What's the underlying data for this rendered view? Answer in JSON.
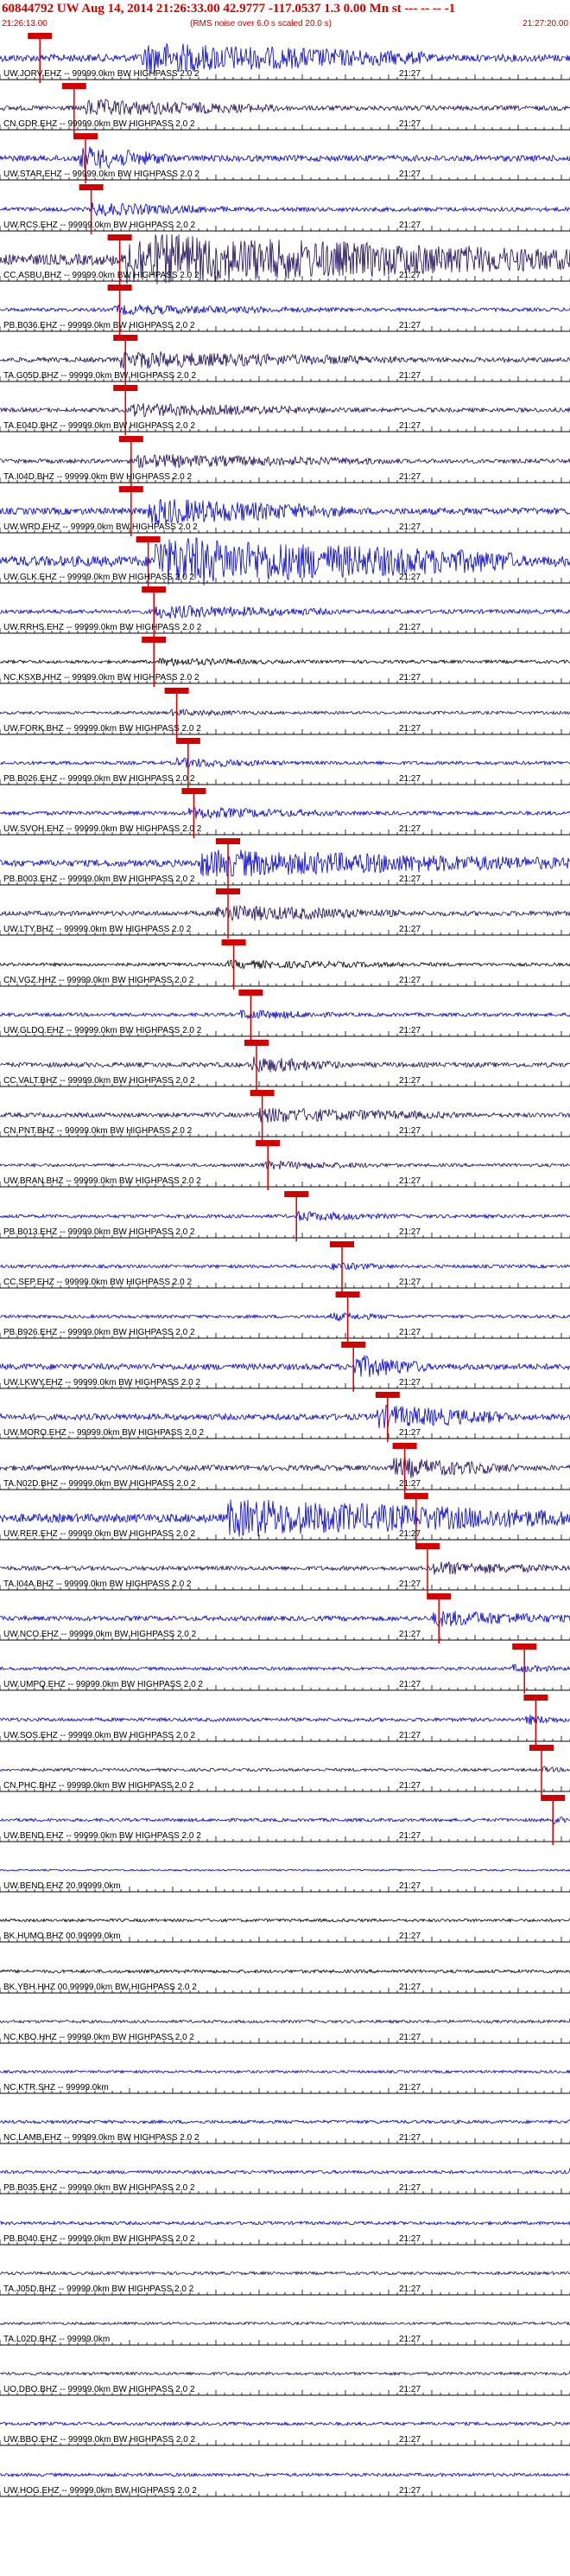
{
  "header": {
    "title": "60844792 UW Aug 14, 2014 21:26:33.00   42.9777 -117.0537  1.3 0.00 Mn st --- -- --  -1",
    "start_time": "21:26:13.00",
    "end_time": "21:27:20.00",
    "note": "(RMS noise over 6.0 s scaled 20.0 s)"
  },
  "tick_label": "21:27",
  "colors": {
    "header": "#d40000",
    "pick": "#d40000",
    "blue": "#0000cc",
    "dark": "#1a0a5a",
    "black": "#000000",
    "axis": "#000000"
  },
  "traces": [
    {
      "label": "UW.JORV.EHZ -- 99999.0km BW  HIGHPASS  2.0  2",
      "color": "#0000cc",
      "amp": 18,
      "burst": [
        0.25,
        0.75
      ],
      "pick": 0.07
    },
    {
      "label": "CN.GDR.EHZ -- 99999.0km BW  HIGHPASS  2.0  2",
      "color": "#1a0a5a",
      "amp": 10,
      "burst": [
        0.15,
        0.5
      ],
      "pick": 0.13
    },
    {
      "label": "UW.STAR.EHZ -- 99999.0km BW  HIGHPASS  2.0  2",
      "color": "#0000cc",
      "amp": 14,
      "burst": [
        0.14,
        0.3
      ],
      "pick": 0.15
    },
    {
      "label": "UW.RCS.EHZ -- 99999.0km BW  HIGHPASS  2.0  2",
      "color": "#0000cc",
      "amp": 8,
      "burst": [
        0.16,
        0.4
      ],
      "pick": 0.16
    },
    {
      "label": "CC.ASBU.BHZ -- 99999.0km BW  HIGHPASS  2.0  2",
      "color": "#1a0a5a",
      "amp": 30,
      "burst": [
        0.22,
        1.0
      ],
      "pick": 0.21
    },
    {
      "label": "PB.B036.EHZ -- 99999.0km BW  HIGHPASS  2.0  2",
      "color": "#0000cc",
      "amp": 6,
      "burst": [
        0.2,
        0.6
      ],
      "pick": 0.21
    },
    {
      "label": "TA.G05D.BHZ -- 99999.0km BW  HIGHPASS  2.0  2",
      "color": "#1a0a5a",
      "amp": 10,
      "burst": [
        0.21,
        0.7
      ],
      "pick": 0.22
    },
    {
      "label": "TA.E04D.BHZ -- 99999.0km BW  HIGHPASS  2.0  2",
      "color": "#1a0a5a",
      "amp": 8,
      "burst": [
        0.23,
        0.6
      ],
      "pick": 0.22
    },
    {
      "label": "TA.I04D.BHZ -- 99999.0km BW  HIGHPASS  2.0  2",
      "color": "#1a0a5a",
      "amp": 8,
      "burst": [
        0.24,
        0.7
      ],
      "pick": 0.23
    },
    {
      "label": "UW.WRD.EHZ -- 99999.0km BW  HIGHPASS  2.0  2",
      "color": "#0000cc",
      "amp": 16,
      "burst": [
        0.26,
        0.6
      ],
      "pick": 0.23
    },
    {
      "label": "UW.GLK.EHZ -- 99999.0km BW  HIGHPASS  2.0  2",
      "color": "#0000cc",
      "amp": 28,
      "burst": [
        0.27,
        0.9
      ],
      "pick": 0.26
    },
    {
      "label": "UW.RRHS.EHZ -- 99999.0km BW  HIGHPASS  2.0  2",
      "color": "#0000cc",
      "amp": 8,
      "burst": [
        0.27,
        0.6
      ],
      "pick": 0.27
    },
    {
      "label": "NC.KSXB.HHZ -- 99999.0km BW  HIGHPASS  2.0  2",
      "color": "#000000",
      "amp": 5,
      "burst": [
        0.28,
        0.5
      ],
      "pick": 0.27
    },
    {
      "label": "UW.FORK.BHZ -- 99999.0km BW  HIGHPASS  2.0  2",
      "color": "#1a0a5a",
      "amp": 4,
      "burst": [
        0.3,
        0.5
      ],
      "pick": 0.31
    },
    {
      "label": "PB.B026.EHZ -- 99999.0km BW  HIGHPASS  2.0  2",
      "color": "#0000cc",
      "amp": 6,
      "burst": [
        0.31,
        0.5
      ],
      "pick": 0.33
    },
    {
      "label": "UW.SVOH.EHZ -- 99999.0km BW  HIGHPASS  2.0  2",
      "color": "#0000cc",
      "amp": 7,
      "burst": [
        0.33,
        0.6
      ],
      "pick": 0.34
    },
    {
      "label": "PB.B003.EHZ -- 99999.0km BW  HIGHPASS  2.0  2",
      "color": "#0000cc",
      "amp": 16,
      "burst": [
        0.35,
        1.0
      ],
      "pick": 0.4
    },
    {
      "label": "UW.LTY.BHZ -- 99999.0km BW  HIGHPASS  2.0  2",
      "color": "#1a0a5a",
      "amp": 10,
      "burst": [
        0.38,
        0.7
      ],
      "pick": 0.4
    },
    {
      "label": "CN.VGZ.HHZ -- 99999.0km BW  HIGHPASS  2.0  2",
      "color": "#000000",
      "amp": 5,
      "burst": [
        0.4,
        0.8
      ],
      "pick": 0.41
    },
    {
      "label": "UW.GLDO.EHZ -- 99999.0km BW  HIGHPASS  2.0  2",
      "color": "#0000cc",
      "amp": 6,
      "burst": [
        0.42,
        0.6
      ],
      "pick": 0.44
    },
    {
      "label": "CC.VALT.BHZ -- 99999.0km BW  HIGHPASS  2.0  2",
      "color": "#1a0a5a",
      "amp": 10,
      "burst": [
        0.44,
        0.6
      ],
      "pick": 0.45
    },
    {
      "label": "CN.PNT.BHZ -- 99999.0km BW  HIGHPASS  2.0  2",
      "color": "#1a0a5a",
      "amp": 9,
      "burst": [
        0.45,
        0.8
      ],
      "pick": 0.46
    },
    {
      "label": "UW.BRAN.BHZ -- 99999.0km BW  HIGHPASS  2.0  2",
      "color": "#1a0a5a",
      "amp": 5,
      "burst": [
        0.46,
        0.7
      ],
      "pick": 0.47
    },
    {
      "label": "PB.B013.EHZ -- 99999.0km BW  HIGHPASS  2.0  2",
      "color": "#0000cc",
      "amp": 6,
      "burst": [
        0.52,
        0.7
      ],
      "pick": 0.52
    },
    {
      "label": "CC.SEP.EHZ -- 99999.0km BW  HIGHPASS  2.0  2",
      "color": "#0000cc",
      "amp": 5,
      "burst": [
        0.58,
        0.7
      ],
      "pick": 0.6
    },
    {
      "label": "PB.B926.EHZ -- 99999.0km BW  HIGHPASS  2.0  2",
      "color": "#0000cc",
      "amp": 5,
      "burst": [
        0.58,
        0.7
      ],
      "pick": 0.61
    },
    {
      "label": "UW.LKWY.EHZ -- 99999.0km BW  HIGHPASS  2.0  2",
      "color": "#0000cc",
      "amp": 14,
      "burst": [
        0.62,
        0.75
      ],
      "pick": 0.62
    },
    {
      "label": "UW.MORO.EHZ -- 99999.0km BW  HIGHPASS  2.0  2",
      "color": "#0000cc",
      "amp": 14,
      "burst": [
        0.66,
        0.9
      ],
      "pick": 0.68
    },
    {
      "label": "TA.N02D.BHZ -- 99999.0km BW  HIGHPASS  2.0  2",
      "color": "#1a0a5a",
      "amp": 12,
      "burst": [
        0.69,
        0.9
      ],
      "pick": 0.71
    },
    {
      "label": "UW.RER.EHZ -- 99999.0km BW  HIGHPASS  2.0  2",
      "color": "#0000cc",
      "amp": 22,
      "burst": [
        0.4,
        1.0
      ],
      "pick": 0.73
    },
    {
      "label": "TA.I04A.BHZ -- 99999.0km BW  HIGHPASS  2.0  2",
      "color": "#1a0a5a",
      "amp": 8,
      "burst": [
        0.76,
        1.0
      ],
      "pick": 0.75
    },
    {
      "label": "UW.NCO.EHZ -- 99999.0km BW  HIGHPASS  2.0  2",
      "color": "#0000cc",
      "amp": 10,
      "burst": [
        0.76,
        1.0
      ],
      "pick": 0.77
    },
    {
      "label": "UW.UMPQ.EHZ -- 99999.0km BW  HIGHPASS  2.0  2",
      "color": "#0000cc",
      "amp": 5,
      "burst": [
        0.9,
        1.0
      ],
      "pick": 0.92
    },
    {
      "label": "UW.SOS.EHZ -- 99999.0km BW  HIGHPASS  2.0  2",
      "color": "#0000cc",
      "amp": 6,
      "burst": [
        0.92,
        1.0
      ],
      "pick": 0.94
    },
    {
      "label": "CN.PHC.BHZ -- 99999.0km BW  HIGHPASS  2.0  2",
      "color": "#1a0a5a",
      "amp": 4,
      "burst": [
        0.95,
        1.0
      ],
      "pick": 0.95
    },
    {
      "label": "UW.BEND.EHZ -- 99999.0km BW  HIGHPASS  2.0  2",
      "color": "#0000cc",
      "amp": 5,
      "burst": [
        0.97,
        1.0
      ],
      "pick": 0.97
    },
    {
      "label": "UW.BEND.EHZ 20.99999.0km",
      "color": "#0000cc",
      "amp": 0,
      "burst": [
        1.0,
        1.0
      ],
      "pick": null
    },
    {
      "label": "BK.HUMO.BHZ 00.99999.0km",
      "color": "#000000",
      "amp": 4,
      "burst": [
        1.0,
        1.0
      ],
      "pick": null
    },
    {
      "label": "BK.YBH.HHZ 00.99999.0km BW  HIGHPASS  2.0  2",
      "color": "#000000",
      "amp": 5,
      "burst": [
        1.0,
        1.0
      ],
      "pick": null
    },
    {
      "label": "NC.KBO.HHZ -- 99999.0km BW  HIGHPASS  2.0  2",
      "color": "#1a0a5a",
      "amp": 4,
      "burst": [
        1.0,
        1.0
      ],
      "pick": null
    },
    {
      "label": "NC.KTR.SHZ -- 99999.0km",
      "color": "#0000cc",
      "amp": 3,
      "burst": [
        1.0,
        1.0
      ],
      "pick": null
    },
    {
      "label": "NC.LAMB.EHZ -- 99999.0km BW  HIGHPASS  2.0  2",
      "color": "#0000cc",
      "amp": 5,
      "burst": [
        1.0,
        1.0
      ],
      "pick": null
    },
    {
      "label": "PB.B035.EHZ -- 99999.0km BW  HIGHPASS  2.0  2",
      "color": "#0000cc",
      "amp": 5,
      "burst": [
        1.0,
        1.0
      ],
      "pick": null
    },
    {
      "label": "PB.B040.EHZ -- 99999.0km BW  HIGHPASS  2.0  2",
      "color": "#0000cc",
      "amp": 5,
      "burst": [
        1.0,
        1.0
      ],
      "pick": null
    },
    {
      "label": "TA.J05D.BHZ -- 99999.0km BW  HIGHPASS  2.0  2",
      "color": "#1a0a5a",
      "amp": 4,
      "burst": [
        1.0,
        1.0
      ],
      "pick": null
    },
    {
      "label": "TA.L02D.BHZ -- 99999.0km",
      "color": "#1a0a5a",
      "amp": 3,
      "burst": [
        1.0,
        1.0
      ],
      "pick": null
    },
    {
      "label": "UO.DBO.BHZ -- 99999.0km BW  HIGHPASS  2.0  2",
      "color": "#1a0a5a",
      "amp": 4,
      "burst": [
        1.0,
        1.0
      ],
      "pick": null
    },
    {
      "label": "UW.BBO.EHZ -- 99999.0km BW  HIGHPASS  2.0  2",
      "color": "#0000cc",
      "amp": 5,
      "burst": [
        1.0,
        1.0
      ],
      "pick": null
    },
    {
      "label": "UW.HOG.EHZ -- 99999.0km BW  HIGHPASS  2.0  2",
      "color": "#0000cc",
      "amp": 5,
      "burst": [
        1.0,
        1.0
      ],
      "pick": null
    }
  ]
}
